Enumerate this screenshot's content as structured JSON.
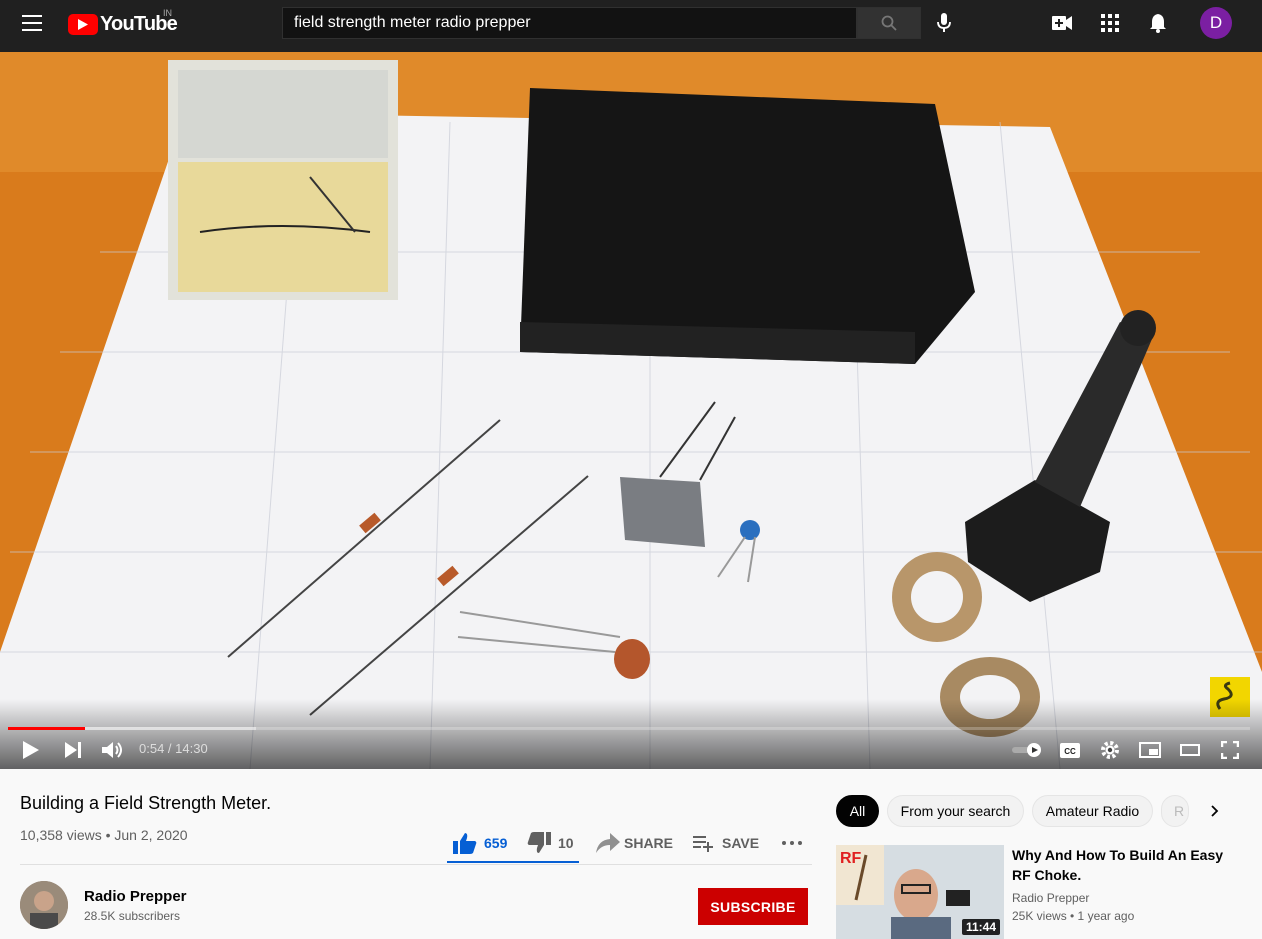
{
  "header": {
    "logo_text": "YouTube",
    "country_code": "IN",
    "search_value": "field strength meter radio prepper",
    "avatar_letter": "D"
  },
  "player": {
    "time_display": "0:54 / 14:30",
    "played_fraction": 0.062,
    "buffered_fraction": 0.2
  },
  "video": {
    "title": "Building a Field Strength Meter.",
    "views_date": "10,358 views • Jun 2, 2020",
    "like_count": "659",
    "dislike_count": "10",
    "share_label": "SHARE",
    "save_label": "SAVE"
  },
  "channel": {
    "name": "Radio Prepper",
    "subscribers": "28.5K subscribers",
    "subscribe_label": "SUBSCRIBE"
  },
  "chips": [
    "All",
    "From your search",
    "Amateur Radio",
    "R"
  ],
  "recommendation": {
    "title": "Why And How To Build An Easy RF Choke.",
    "channel": "Radio Prepper",
    "meta": "25K views • 1 year ago",
    "duration": "11:44",
    "thumb_text": "RF"
  },
  "colors": {
    "accent_red": "#ff0000",
    "like_blue": "#065fd4",
    "subscribe_red": "#cc0000",
    "avatar_purple": "#7b1fa2"
  }
}
